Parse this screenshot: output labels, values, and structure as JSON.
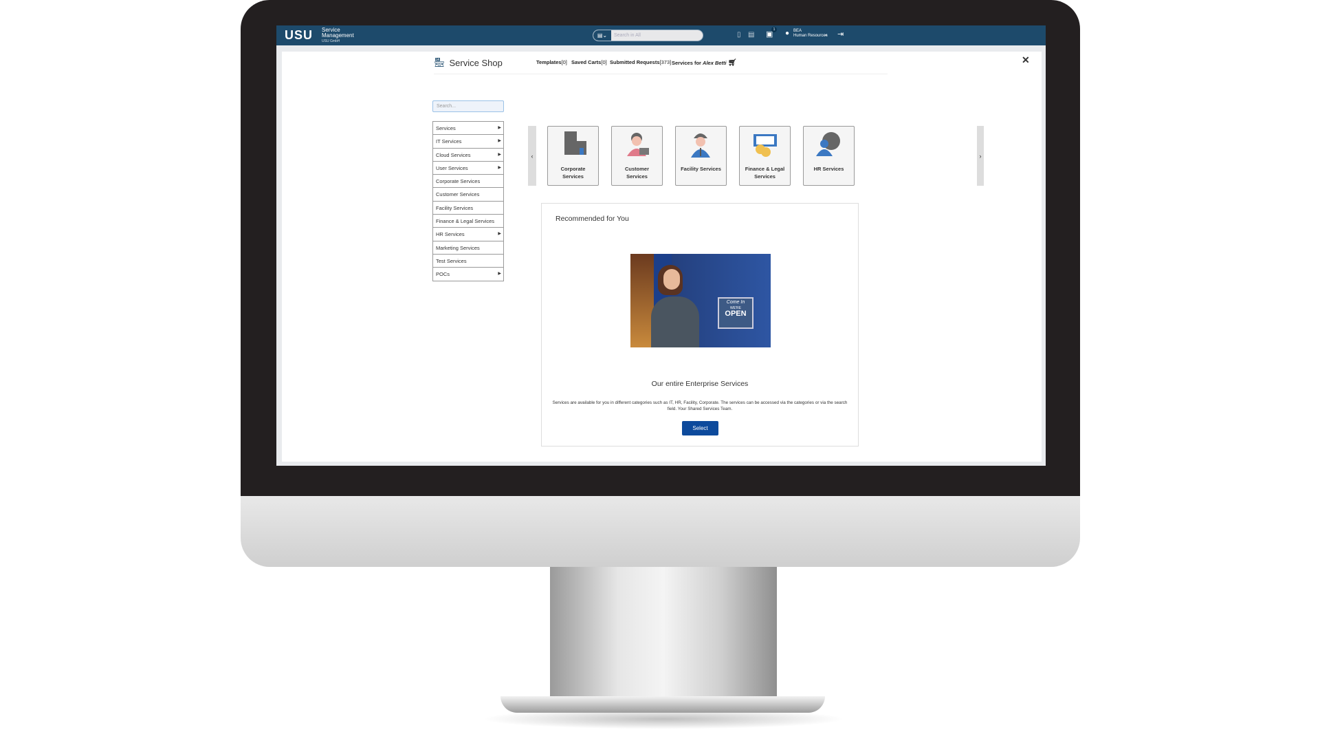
{
  "header": {
    "logo": "USU",
    "product_line1": "Service",
    "product_line2": "Management",
    "company": "USU GmbH",
    "search_placeholder": "Search in All",
    "notification_count": "1",
    "user_name": "BEA",
    "user_dept": "Human Resources"
  },
  "shop": {
    "title": "Service Shop",
    "templates_label": "Templates",
    "templates_count": "[0]",
    "saved_carts_label": "Saved Carts",
    "saved_carts_count": "[0]",
    "submitted_label": "Submitted Requests",
    "submitted_count": "[373]",
    "services_for_label": "Services for",
    "services_for_user": "Alex Betti",
    "close": "✕"
  },
  "sidebar": {
    "search_placeholder": "Search...",
    "items": [
      {
        "label": "Services",
        "sub": true
      },
      {
        "label": "IT Services",
        "sub": true
      },
      {
        "label": "Cloud Services",
        "sub": true
      },
      {
        "label": "User Services",
        "sub": true
      },
      {
        "label": "Corporate Services",
        "sub": false
      },
      {
        "label": "Customer Services",
        "sub": false
      },
      {
        "label": "Facility Services",
        "sub": false
      },
      {
        "label": "Finance & Legal Services",
        "sub": false
      },
      {
        "label": "HR Services",
        "sub": true
      },
      {
        "label": "Marketing Services",
        "sub": false
      },
      {
        "label": "Test Services",
        "sub": false
      },
      {
        "label": "POCs",
        "sub": true
      }
    ]
  },
  "categories": [
    {
      "line1": "Corporate",
      "line2": "Services",
      "icon": "building-icon"
    },
    {
      "line1": "Customer",
      "line2": "Services",
      "icon": "shopper-icon"
    },
    {
      "line1": "Facility Services",
      "line2": "",
      "icon": "worker-icon"
    },
    {
      "line1": "Finance & Legal",
      "line2": "Services",
      "icon": "money-icon"
    },
    {
      "line1": "HR Services",
      "line2": "",
      "icon": "globe-person-icon"
    }
  ],
  "recommended": {
    "heading": "Recommended for You",
    "sign_line1": "Come In",
    "sign_line2": "WE'RE",
    "sign_line3": "OPEN",
    "title": "Our entire Enterprise Services",
    "description": "Services are available for you in different categories such as IT, HR, Facility, Corporate. The services can be accessed via the categories or via the search field. Your Shared Services Team.",
    "button": "Select"
  },
  "colors": {
    "topbar": "#1d4a6b",
    "button": "#0d4a9c"
  }
}
